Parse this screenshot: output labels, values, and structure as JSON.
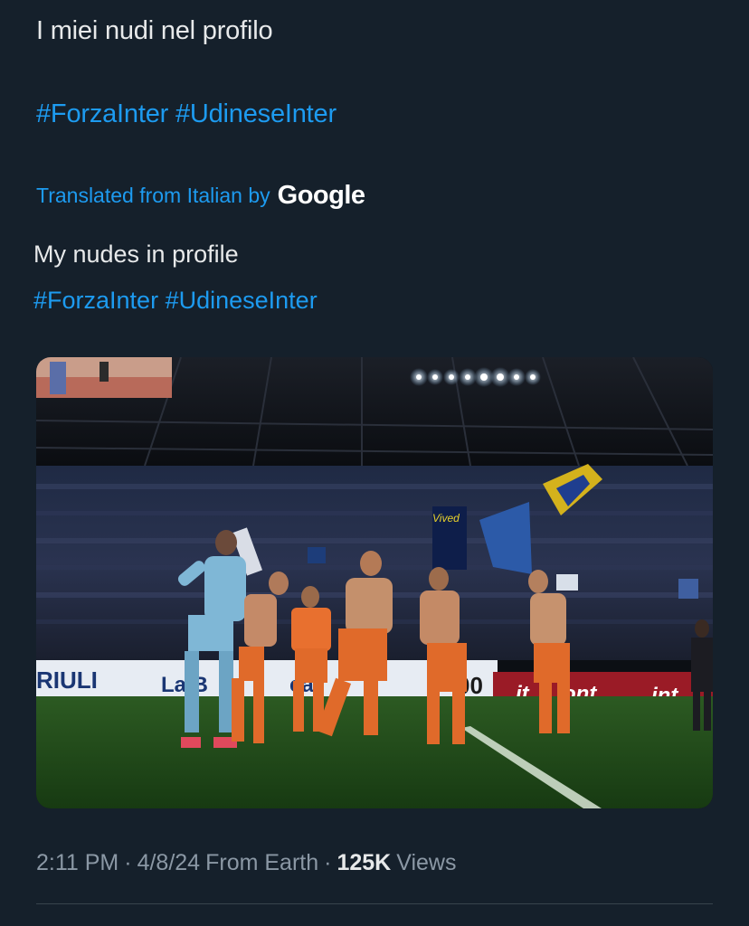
{
  "tweet": {
    "original_text": "I miei nudi nel profilo",
    "hashtags": [
      "#ForzaInter",
      "#UdineseInter"
    ],
    "translated_label": "Translated from Italian by",
    "translator_logo": "Google",
    "translation_text": "My nudes in profile",
    "translation_hashtags": [
      "#ForzaInter",
      "#UdineseInter"
    ],
    "media": {
      "icon": "photo",
      "board_texts": [
        "RIULI",
        "La B",
        "ca",
        "00",
        "it",
        "ont",
        "int"
      ],
      "banner_text": "Vived"
    },
    "meta": {
      "time": "2:11 PM",
      "date": "4/8/24",
      "source": "From Earth",
      "views_count": "125K",
      "views_label": "Views",
      "separator": "·"
    }
  },
  "colors": {
    "background": "#15202b",
    "text": "#e7e9ea",
    "link": "#1d9bf0",
    "secondary": "#8b98a5",
    "divider": "#38444d"
  }
}
